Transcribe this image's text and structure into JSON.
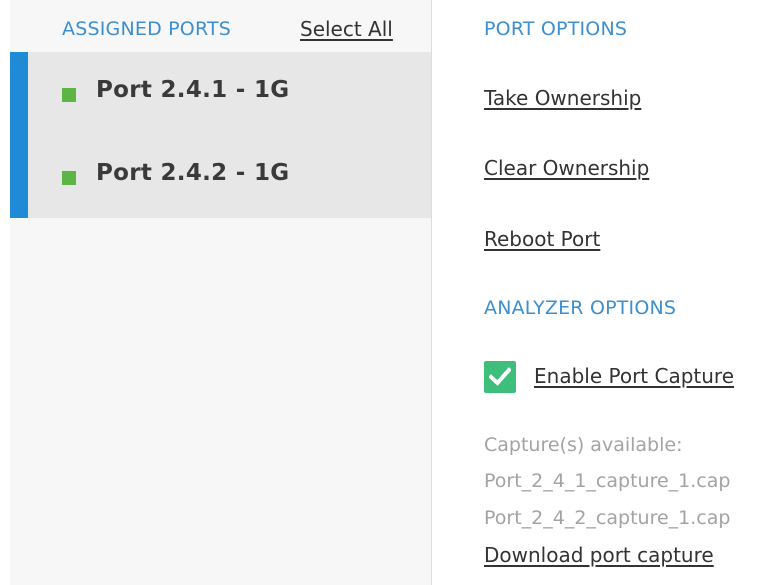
{
  "assigned_ports": {
    "title": "ASSIGNED PORTS",
    "select_all_label": "Select All",
    "items": [
      {
        "label": "Port 2.4.1 - 1G",
        "status": "online",
        "status_color": "#5cb545"
      },
      {
        "label": "Port 2.4.2 - 1G",
        "status": "online",
        "status_color": "#5cb545"
      }
    ],
    "selected_accent_color": "#1f8ad6"
  },
  "port_options": {
    "title": "PORT OPTIONS",
    "actions": [
      {
        "label": "Take Ownership"
      },
      {
        "label": "Clear Ownership"
      },
      {
        "label": "Reboot Port"
      }
    ]
  },
  "analyzer_options": {
    "title": "ANALYZER OPTIONS",
    "enable_capture": {
      "label": "Enable Port Capture",
      "checked": true,
      "checkbox_color": "#3dbf7b"
    },
    "captures_heading": "Capture(s) available:",
    "capture_files": [
      "Port_2_4_1_capture_1.cap",
      "Port_2_4_2_capture_1.cap"
    ],
    "download_label": "Download port capture"
  },
  "colors": {
    "section_title": "#3d8fcf",
    "link_text": "#333333",
    "muted_text": "#a3a3a3"
  }
}
